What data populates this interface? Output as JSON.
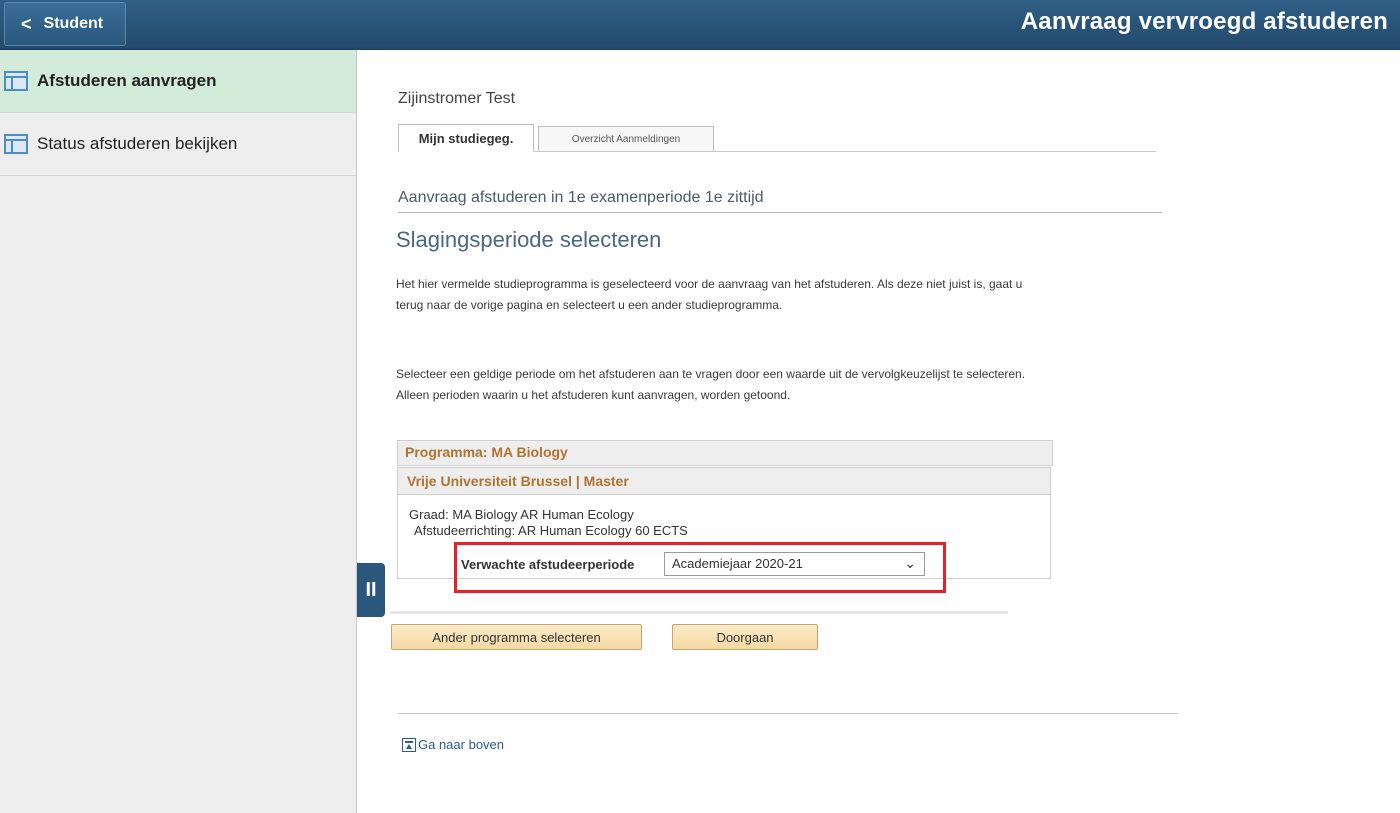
{
  "header": {
    "back_label": "Student",
    "title": "Aanvraag vervroegd afstuderen"
  },
  "sidebar": {
    "items": [
      {
        "label": "Afstuderen aanvragen",
        "active": true,
        "icon": "page-icon"
      },
      {
        "label": "Status afstuderen bekijken",
        "active": false,
        "icon": "page-icon"
      }
    ]
  },
  "main": {
    "user_name": "Zijinstromer Test",
    "tabs": [
      {
        "label": "Mijn studiegeg.",
        "active": true
      },
      {
        "label": "Overzicht Aanmeldingen",
        "active": false
      }
    ],
    "section_title": "Aanvraag afstuderen in 1e examenperiode 1e zittijd",
    "page_heading": "Slagingsperiode selecteren",
    "para1": "Het hier vermelde studieprogramma is geselecteerd voor de aanvraag van het afstuderen. Als deze niet juist is, gaat u terug naar de vorige pagina en selecteert u een ander studieprogramma.",
    "para2": "Selecteer een geldige periode om het afstuderen aan te vragen door een waarde uit de vervolgkeuzelijst te selecteren. Alleen perioden waarin u het afstuderen kunt aanvragen, worden getoond.",
    "program_title": "Programma: MA Biology",
    "institution_title": "Vrije Universiteit Brussel | Master",
    "graad": "Graad: MA Biology AR Human Ecology",
    "afstudeerrichting": "Afstudeerrichting: AR Human Ecology 60 ECTS",
    "period_label": "Verwachte afstudeerperiode",
    "period_value": "Academiejaar 2020-21",
    "buttons": {
      "other_program": "Ander programma selecteren",
      "continue": "Doorgaan"
    },
    "top_link": "Ga naar boven"
  },
  "colors": {
    "header_bg": "#2a577e",
    "active_nav_bg": "#d3ecd9",
    "heading_color": "#4a6783",
    "orange_text": "#b4722f",
    "highlight_border": "#e5202a",
    "button_bg": "#f5d9a2"
  }
}
